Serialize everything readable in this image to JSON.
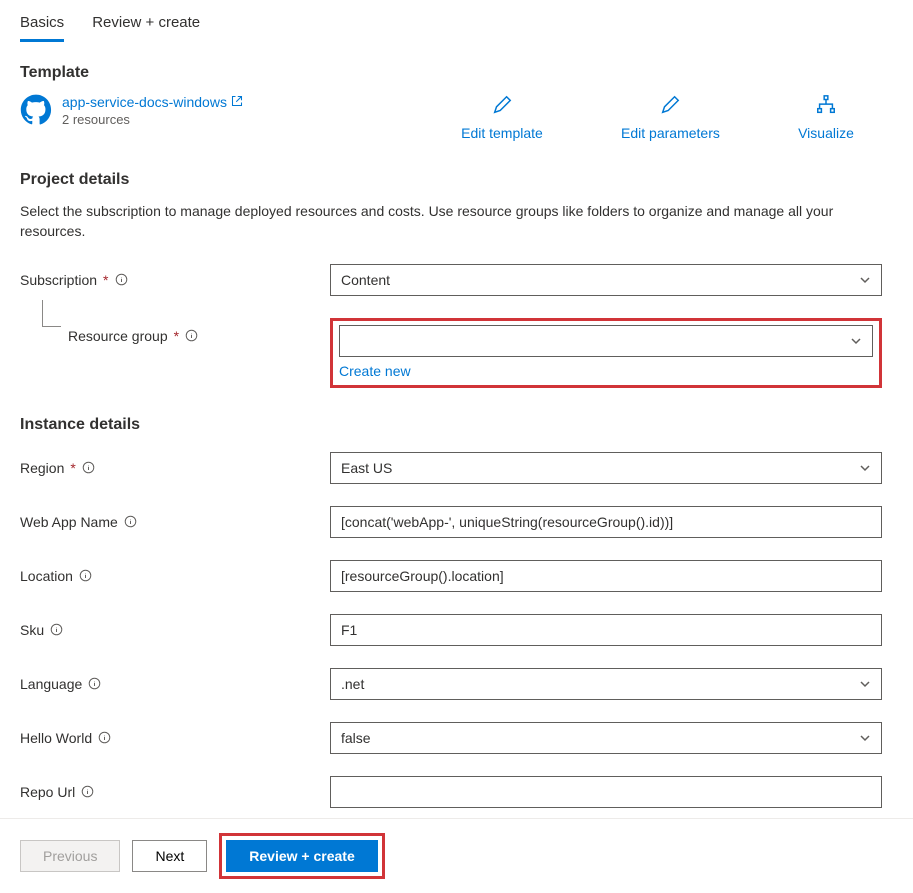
{
  "tabs": {
    "basics": "Basics",
    "review": "Review + create"
  },
  "template": {
    "heading": "Template",
    "name": "app-service-docs-windows",
    "resources": "2 resources",
    "actions": {
      "edit_template": "Edit template",
      "edit_params": "Edit parameters",
      "visualize": "Visualize"
    }
  },
  "project": {
    "heading": "Project details",
    "desc": "Select the subscription to manage deployed resources and costs. Use resource groups like folders to organize and manage all your resources.",
    "subscription_label": "Subscription",
    "subscription_value": "Content",
    "rg_label": "Resource group",
    "rg_value": "",
    "create_new": "Create new"
  },
  "instance": {
    "heading": "Instance details",
    "region_label": "Region",
    "region_value": "East US",
    "webapp_label": "Web App Name",
    "webapp_value": "[concat('webApp-', uniqueString(resourceGroup().id))]",
    "location_label": "Location",
    "location_value": "[resourceGroup().location]",
    "sku_label": "Sku",
    "sku_value": "F1",
    "language_label": "Language",
    "language_value": ".net",
    "hello_label": "Hello World",
    "hello_value": "false",
    "repo_label": "Repo Url",
    "repo_value": ""
  },
  "footer": {
    "previous": "Previous",
    "next": "Next",
    "review": "Review + create"
  }
}
